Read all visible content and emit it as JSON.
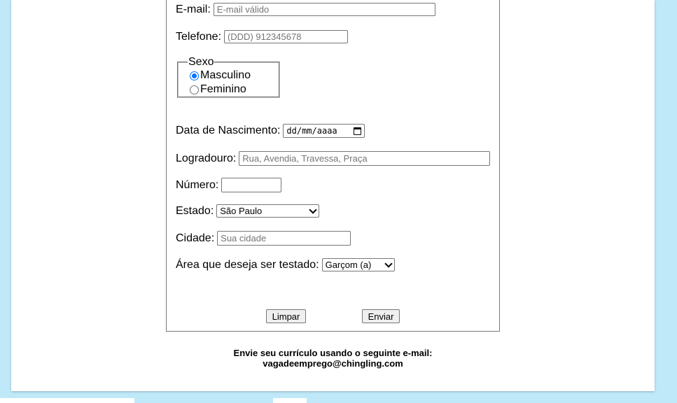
{
  "form": {
    "email": {
      "label": "E-mail:",
      "placeholder": "E-mail válido",
      "value": ""
    },
    "telefone": {
      "label": "Telefone:",
      "placeholder": "(DDD) 912345678",
      "value": ""
    },
    "sexo": {
      "legend": "Sexo",
      "options": [
        {
          "label": "Masculino",
          "checked": true
        },
        {
          "label": "Feminino",
          "checked": false
        }
      ]
    },
    "nascimento": {
      "label": "Data de Nascimento:",
      "value": "dd/mm/aaaa",
      "icon": "calendar-icon"
    },
    "logradouro": {
      "label": "Logradouro:",
      "placeholder": "Rua, Avendia, Travessa, Praça",
      "value": ""
    },
    "numero": {
      "label": "Número:",
      "placeholder": "",
      "value": ""
    },
    "estado": {
      "label": "Estado:",
      "selected": "São Paulo",
      "icon": "chevron-down-icon"
    },
    "cidade": {
      "label": "Cidade:",
      "placeholder": "Sua cidade",
      "value": ""
    },
    "area": {
      "label": "Área que deseja ser testado:",
      "selected": "Garçom (a)",
      "icon": "chevron-down-icon"
    },
    "buttons": {
      "clear": "Limpar",
      "submit": "Enviar"
    }
  },
  "footer": {
    "line1": "Envie seu currículo usando o seguinte e-mail:",
    "line2": "vagadeemprego@chingling.com"
  },
  "colors": {
    "background": "#bfe9f9",
    "radio_accent": "#0075ff"
  }
}
